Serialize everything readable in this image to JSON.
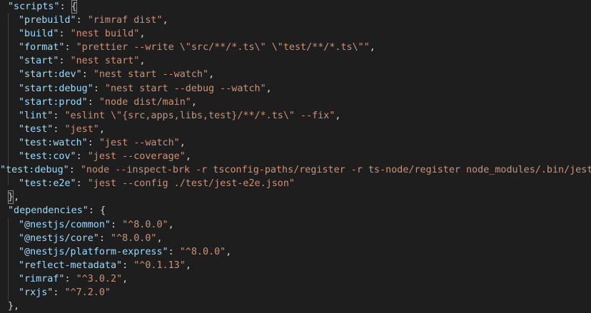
{
  "colors": {
    "background": "#1e1e1e",
    "key": "#9cdcfe",
    "string": "#ce9178",
    "punctuation": "#d4d4d4"
  },
  "scripts": {
    "key": "\"scripts\"",
    "open": "{",
    "close": "}",
    "entries": [
      {
        "key": "\"prebuild\"",
        "value": "\"rimraf dist\""
      },
      {
        "key": "\"build\"",
        "value": "\"nest build\""
      },
      {
        "key": "\"format\"",
        "value": "\"prettier --write \\\"src/**/*.ts\\\" \\\"test/**/*.ts\\\"\""
      },
      {
        "key": "\"start\"",
        "value": "\"nest start\""
      },
      {
        "key": "\"start:dev\"",
        "value": "\"nest start --watch\""
      },
      {
        "key": "\"start:debug\"",
        "value": "\"nest start --debug --watch\""
      },
      {
        "key": "\"start:prod\"",
        "value": "\"node dist/main\""
      },
      {
        "key": "\"lint\"",
        "value": "\"eslint \\\"{src,apps,libs,test}/**/*.ts\\\" --fix\""
      },
      {
        "key": "\"test\"",
        "value": "\"jest\""
      },
      {
        "key": "\"test:watch\"",
        "value": "\"jest --watch\""
      },
      {
        "key": "\"test:cov\"",
        "value": "\"jest --coverage\""
      },
      {
        "key": "\"test:debug\"",
        "value": "\"node --inspect-brk -r tsconfig-paths/register -r ts-node/register node_modules/.bin/jest"
      },
      {
        "key": "\"test:e2e\"",
        "value": "\"jest --config ./test/jest-e2e.json\""
      }
    ]
  },
  "dependencies": {
    "key": "\"dependencies\"",
    "open": "{",
    "close": "}",
    "entries": [
      {
        "key": "\"@nestjs/common\"",
        "value": "\"^8.0.0\""
      },
      {
        "key": "\"@nestjs/core\"",
        "value": "\"^8.0.0\""
      },
      {
        "key": "\"@nestjs/platform-express\"",
        "value": "\"^8.0.0\""
      },
      {
        "key": "\"reflect-metadata\"",
        "value": "\"^0.1.13\""
      },
      {
        "key": "\"rimraf\"",
        "value": "\"^3.0.2\""
      },
      {
        "key": "\"rxjs\"",
        "value": "\"^7.2.0\""
      }
    ]
  }
}
